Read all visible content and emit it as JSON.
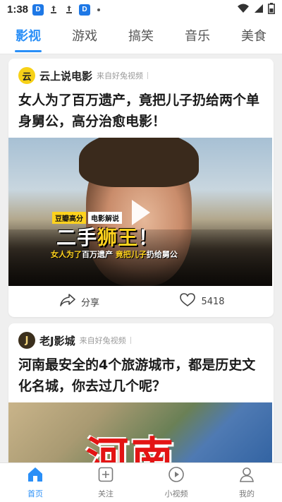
{
  "status_bar": {
    "time": "1:38",
    "badge_letter": "D"
  },
  "tabs": [
    {
      "label": "影视",
      "active": true
    },
    {
      "label": "游戏"
    },
    {
      "label": "搞笑"
    },
    {
      "label": "音乐"
    },
    {
      "label": "美食"
    }
  ],
  "feed": [
    {
      "avatar_char": "云",
      "author": "云上说电影",
      "source": "来自好兔视频",
      "title": "女人为了百万遗产，竟把儿子扔给两个单身舅公，高分治愈电影！",
      "thumbnail": {
        "tag1": "豆瓣高分",
        "tag2": "电影解说",
        "caption_white": "二手",
        "caption_yellow": "狮王",
        "caption_end": "！",
        "sub_a": "女人为了",
        "sub_b": "百万遗产 ",
        "sub_c": "竟把儿子",
        "sub_d": "扔给舅公"
      },
      "share_label": "分享",
      "like_count": "5418"
    },
    {
      "avatar_char": "J",
      "author": "老J影城",
      "source": "来自好兔视频",
      "title": "河南最安全的4个旅游城市，都是历史文化名城，你去过几个呢？",
      "thumbnail": {
        "caption": "河南"
      }
    }
  ],
  "bottom_nav": [
    {
      "label": "首页",
      "icon": "home-icon",
      "active": true
    },
    {
      "label": "关注",
      "icon": "plus-square-icon"
    },
    {
      "label": "小视频",
      "icon": "play-circle-icon"
    },
    {
      "label": "我的",
      "icon": "user-icon"
    }
  ],
  "colors": {
    "accent": "#2a8ff7",
    "badge": "#1e78e6",
    "caption_yellow": "#ffd21e",
    "map_red": "#e31414"
  }
}
